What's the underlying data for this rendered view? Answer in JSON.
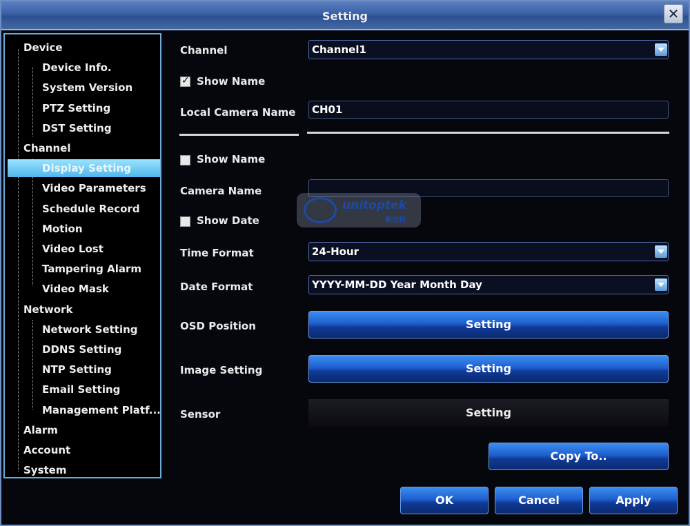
{
  "window": {
    "title": "Setting",
    "close": "✕"
  },
  "sidebar": {
    "items": [
      {
        "label": "Device",
        "level": "cat"
      },
      {
        "label": "Device Info.",
        "level": "sub"
      },
      {
        "label": "System Version",
        "level": "sub"
      },
      {
        "label": "PTZ Setting",
        "level": "sub"
      },
      {
        "label": "DST Setting",
        "level": "sub"
      },
      {
        "label": "Channel",
        "level": "cat"
      },
      {
        "label": "Display Setting",
        "level": "sub",
        "active": true
      },
      {
        "label": "Video Parameters",
        "level": "sub"
      },
      {
        "label": "Schedule Record",
        "level": "sub"
      },
      {
        "label": "Motion",
        "level": "sub"
      },
      {
        "label": "Video Lost",
        "level": "sub"
      },
      {
        "label": "Tampering Alarm",
        "level": "sub"
      },
      {
        "label": "Video Mask",
        "level": "sub"
      },
      {
        "label": "Network",
        "level": "cat"
      },
      {
        "label": "Network Setting",
        "level": "sub"
      },
      {
        "label": "DDNS Setting",
        "level": "sub"
      },
      {
        "label": "NTP Setting",
        "level": "sub"
      },
      {
        "label": "Email Setting",
        "level": "sub"
      },
      {
        "label": "Management Platf...",
        "level": "sub"
      },
      {
        "label": "Alarm",
        "level": "cat"
      },
      {
        "label": "Account",
        "level": "cat"
      },
      {
        "label": "System",
        "level": "cat"
      }
    ]
  },
  "form": {
    "channel_label": "Channel",
    "channel_value": "Channel1",
    "show_name_label": "Show Name",
    "local_camera_name_label": "Local Camera Name",
    "local_camera_name_value": "CH01",
    "show_name2_label": "Show Name",
    "camera_name_label": "Camera Name",
    "camera_name_value": "",
    "show_date_label": "Show Date",
    "time_format_label": "Time Format",
    "time_format_value": "24-Hour",
    "date_format_label": "Date Format",
    "date_format_value": "YYYY-MM-DD Year Month Day",
    "osd_position_label": "OSD Position",
    "osd_position_button": "Setting",
    "image_setting_label": "Image Setting",
    "image_setting_button": "Setting",
    "sensor_label": "Sensor",
    "sensor_button": "Setting"
  },
  "buttons": {
    "copy_to": "Copy To..",
    "ok": "OK",
    "cancel": "Cancel",
    "apply": "Apply"
  },
  "watermark": {
    "brand": "unitoptek",
    "sub": "联优科"
  }
}
